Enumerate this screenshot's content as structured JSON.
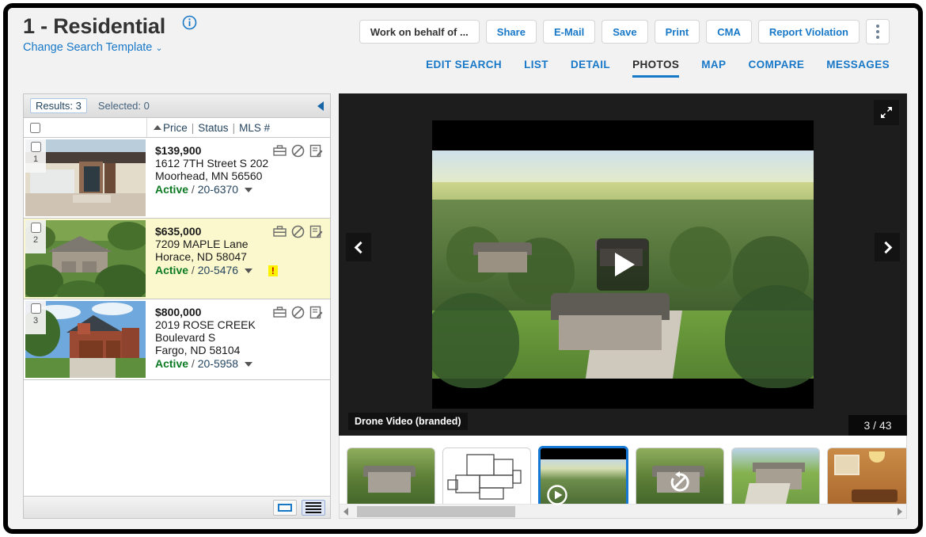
{
  "header": {
    "title": "1 - Residential",
    "info_icon": "info-circle-icon",
    "change_template": "Change Search Template",
    "change_template_caret": "⌄"
  },
  "toolbar": {
    "buttons": [
      {
        "label": "Work on behalf of ...",
        "style": "dark",
        "name": "work-on-behalf-of-button"
      },
      {
        "label": "Share",
        "style": "link",
        "name": "share-button"
      },
      {
        "label": "E-Mail",
        "style": "link",
        "name": "email-button"
      },
      {
        "label": "Save",
        "style": "link",
        "name": "save-button"
      },
      {
        "label": "Print",
        "style": "link",
        "name": "print-button"
      },
      {
        "label": "CMA",
        "style": "link",
        "name": "cma-button"
      },
      {
        "label": "Report Violation",
        "style": "link",
        "name": "report-violation-button"
      }
    ],
    "overflow_icon": "kebab-menu-icon"
  },
  "nav": {
    "tabs": [
      {
        "label": "EDIT SEARCH",
        "active": false
      },
      {
        "label": "LIST",
        "active": false
      },
      {
        "label": "DETAIL",
        "active": false
      },
      {
        "label": "PHOTOS",
        "active": true
      },
      {
        "label": "MAP",
        "active": false
      },
      {
        "label": "COMPARE",
        "active": false
      },
      {
        "label": "MESSAGES",
        "active": false
      }
    ]
  },
  "results_panel": {
    "results_label": "Results: 3",
    "selected_label": "Selected: 0",
    "collapse_icon": "collapse-left-arrow-icon",
    "columns": {
      "sort_caret": "sort-ascending-icon",
      "price": "Price",
      "sep1": "|",
      "status": "Status",
      "sep2": "|",
      "mls": "MLS #"
    },
    "rows": [
      {
        "num": "1",
        "price": "$139,900",
        "address_line1": "1612 7TH Street S 202",
        "address_line2": "Moorhead, MN 56560",
        "address_line3": "",
        "status": "Active",
        "separator": "/",
        "mls_number": "20-6370",
        "highlighted": false,
        "flag": "",
        "icons": [
          "briefcase-icon",
          "no-entry-icon",
          "notes-icon"
        ],
        "thumb_art": "front-entry"
      },
      {
        "num": "2",
        "price": "$635,000",
        "address_line1": "7209 MAPLE Lane",
        "address_line2": "Horace, ND 58047",
        "address_line3": "",
        "status": "Active",
        "separator": "/",
        "mls_number": "20-5476",
        "highlighted": true,
        "flag": "!",
        "icons": [
          "briefcase-icon",
          "no-entry-icon",
          "notes-icon"
        ],
        "thumb_art": "aerial"
      },
      {
        "num": "3",
        "price": "$800,000",
        "address_line1": "2019 ROSE CREEK",
        "address_line2": "Boulevard S",
        "address_line3": "Fargo, ND 58104",
        "status": "Active",
        "separator": "/",
        "mls_number": "20-5958",
        "highlighted": false,
        "flag": "",
        "icons": [
          "briefcase-icon",
          "no-entry-icon",
          "notes-icon"
        ],
        "thumb_art": "brick-house"
      }
    ],
    "footer": {
      "card_view_icon": "card-view-icon",
      "list_view_icon": "list-view-icon",
      "active_view": "list"
    }
  },
  "viewer": {
    "caption": "Drone Video (branded)",
    "counter": "3 / 43",
    "current_index": 3,
    "total": 43,
    "play_icon": "play-icon",
    "prev_icon": "chevron-left-icon",
    "next_icon": "chevron-right-icon",
    "expand_icon": "expand-fullscreen-icon"
  },
  "thumbnails": {
    "items": [
      {
        "art": "aerial",
        "overlay": "",
        "selected": false,
        "name": "thumbnail-aerial-1"
      },
      {
        "art": "floorplan",
        "overlay": "",
        "selected": false,
        "name": "thumbnail-floorplan"
      },
      {
        "art": "video",
        "overlay": "play-icon",
        "selected": true,
        "name": "thumbnail-drone-video"
      },
      {
        "art": "aerial",
        "overlay": "rotate-icon",
        "selected": false,
        "name": "thumbnail-aerial-2"
      },
      {
        "art": "driveway",
        "overlay": "",
        "selected": false,
        "name": "thumbnail-driveway"
      },
      {
        "art": "dining",
        "overlay": "",
        "selected": false,
        "name": "thumbnail-dining-room"
      }
    ],
    "scroll_left_icon": "scroll-left-arrow-icon",
    "scroll_right_icon": "scroll-right-arrow-icon"
  },
  "colors": {
    "link_blue": "#1878c8",
    "active_green": "#0b7a23",
    "highlight_row": "#fcf8cd",
    "flag_yellow": "#fff200",
    "selection_blue": "#1478d4",
    "page_bg": "#f2f2f2"
  }
}
